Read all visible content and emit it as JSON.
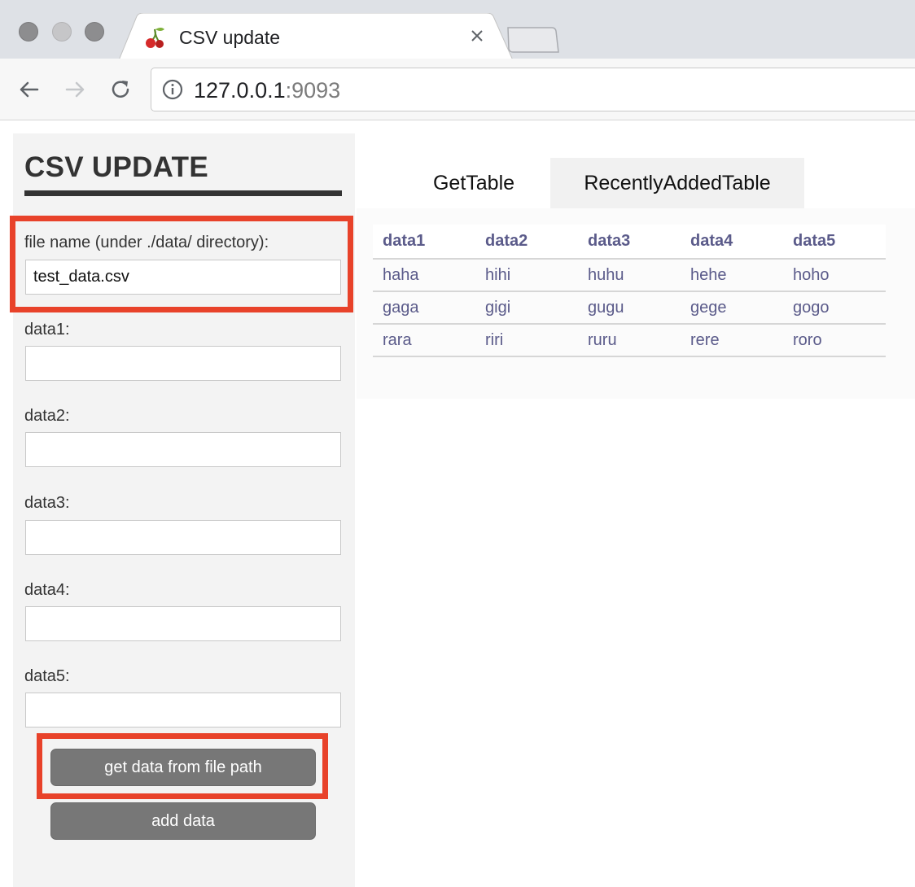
{
  "browser": {
    "tab_title": "CSV update",
    "favicon": "cherry-icon",
    "url_host": "127.0.0.1",
    "url_port": ":9093"
  },
  "sidebar": {
    "title": "CSV UPDATE",
    "file_label": "file name (under ./data/ directory):",
    "file_value": "test_data.csv",
    "fields": [
      {
        "label": "data1:",
        "value": ""
      },
      {
        "label": "data2:",
        "value": ""
      },
      {
        "label": "data3:",
        "value": ""
      },
      {
        "label": "data4:",
        "value": ""
      },
      {
        "label": "data5:",
        "value": ""
      }
    ],
    "get_button_label": "get data from file path",
    "add_button_label": "add data"
  },
  "main": {
    "tabs": [
      {
        "label": "GetTable"
      },
      {
        "label": "RecentlyAddedTable"
      }
    ],
    "table": {
      "columns": [
        "data1",
        "data2",
        "data3",
        "data4",
        "data5"
      ],
      "rows": [
        [
          "haha",
          "hihi",
          "huhu",
          "hehe",
          "hoho"
        ],
        [
          "gaga",
          "gigi",
          "gugu",
          "gege",
          "gogo"
        ],
        [
          "rara",
          "riri",
          "ruru",
          "rere",
          "roro"
        ]
      ]
    }
  },
  "colors": {
    "highlight": "#e8422a",
    "button": "#777777",
    "table_text": "#5b5b8a",
    "sidebar_bg": "#f3f3f3"
  }
}
